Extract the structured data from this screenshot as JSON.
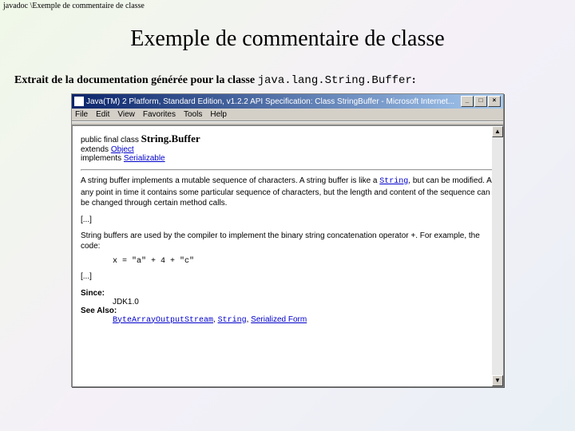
{
  "breadcrumb": "javadoc \\Exemple de commentaire de classe",
  "title": "Exemple de commentaire de classe",
  "intro_prefix": "Extrait de la documentation générée pour la classe ",
  "intro_class": "java.lang.String.Buffer",
  "intro_suffix": ":",
  "window": {
    "titlebar": "Java(TM) 2 Platform, Standard Edition, v1.2.2 API Specification: Class StringBuffer - Microsoft Internet...",
    "menus": [
      "File",
      "Edit",
      "View",
      "Favorites",
      "Tools",
      "Help"
    ],
    "btn_min": "_",
    "btn_max": "□",
    "btn_close": "×",
    "sb_up": "▲",
    "sb_down": "▼"
  },
  "doc": {
    "decl_prefix": "public final class ",
    "decl_class": "String.Buffer",
    "extends_label": "extends ",
    "extends_link": "Object",
    "implements_label": "implements ",
    "implements_link": "Serializable",
    "para1a": "A string buffer implements a mutable sequence of characters. A string buffer is like a ",
    "para1_link": "String",
    "para1b": ", but can be modified. At any point in time it contains some particular sequence of characters, but the length and content of the sequence can be changed through certain method calls.",
    "ellipsis": "[...]",
    "para2": "String buffers are used by the compiler to implement the binary string concatenation operator +. For example, the code:",
    "code": "x = \"a\" + 4 + \"c\"",
    "since_label": "Since:",
    "since_val": "JDK1.0",
    "seealso_label": "See Also:",
    "seealso_links": [
      "ByteArrayOutputStream",
      "String",
      "Serialized Form"
    ]
  }
}
